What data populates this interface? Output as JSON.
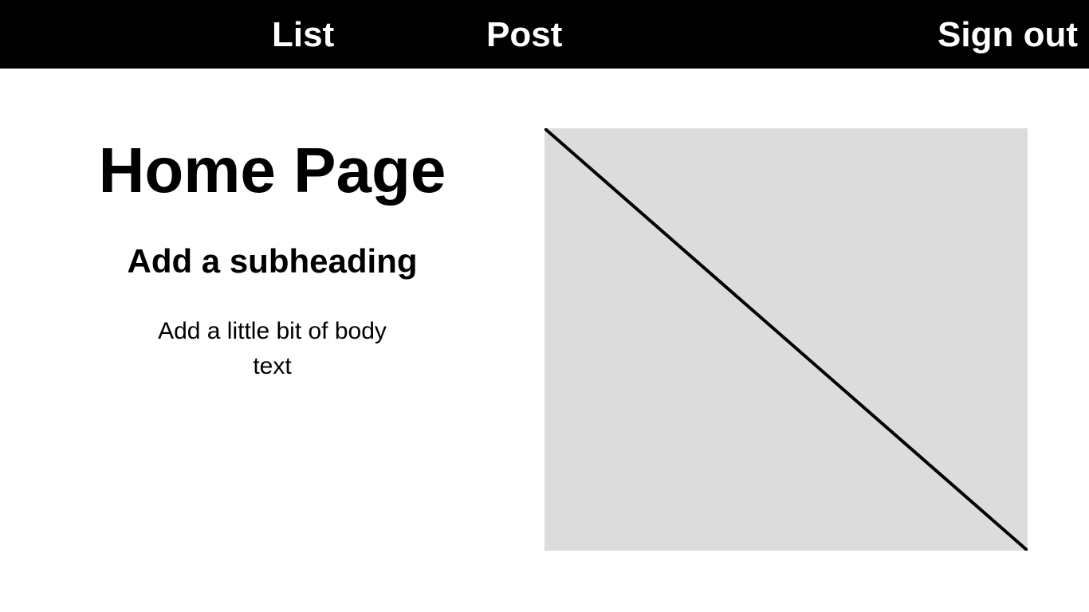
{
  "nav": {
    "list_label": "List",
    "post_label": "Post",
    "signout_label": "Sign out"
  },
  "hero": {
    "title": "Home Page",
    "subheading": "Add a subheading",
    "body": "Add a little bit of body text"
  },
  "image": {
    "icon": "image-placeholder-icon",
    "fill_color": "#dcdcdc"
  },
  "colors": {
    "navbar_bg": "#000000",
    "nav_text": "#ffffff",
    "page_bg": "#ffffff",
    "text": "#000000"
  }
}
